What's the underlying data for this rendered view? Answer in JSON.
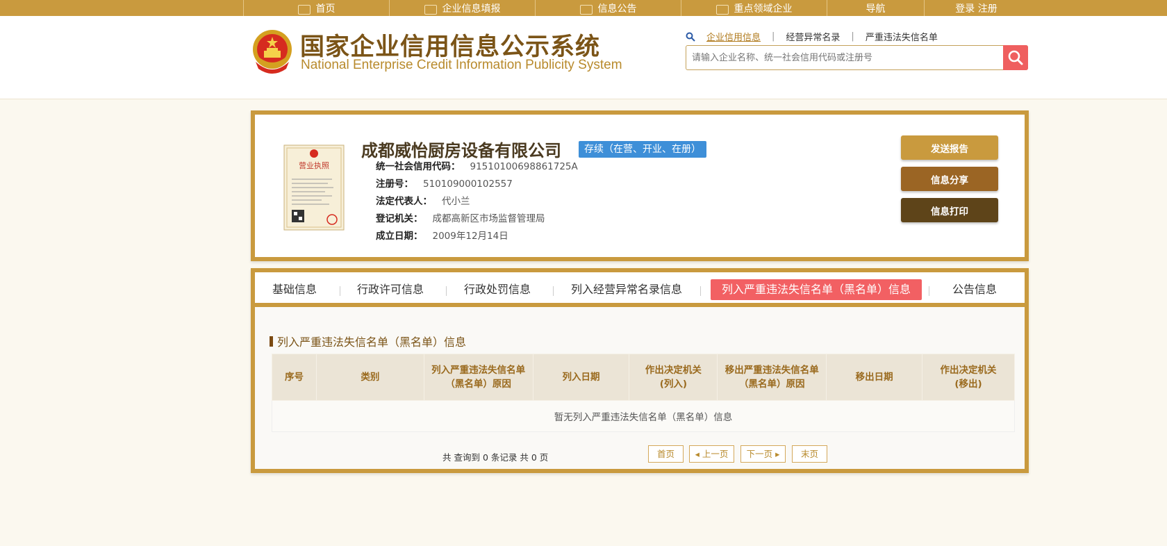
{
  "topnav": {
    "items": [
      {
        "label": "首页",
        "icon": "home-icon"
      },
      {
        "label": "企业信息填报",
        "icon": "edit-icon"
      },
      {
        "label": "信息公告",
        "icon": "notice-icon"
      },
      {
        "label": "重点领域企业",
        "icon": "megaphone-icon"
      },
      {
        "label": "导航",
        "icon": ""
      },
      {
        "label": "登录 注册",
        "icon": ""
      }
    ]
  },
  "header": {
    "title_cn": "国家企业信用信息公示系统",
    "title_en": "National Enterprise Credit Information Publicity System",
    "search_tabs": [
      "企业信用信息",
      "经营异常名录",
      "严重违法失信名单"
    ],
    "search_placeholder": "请输入企业名称、统一社会信用代码或注册号"
  },
  "company": {
    "name": "成都威怡厨房设备有限公司",
    "status": "存续（在营、开业、在册）",
    "fields": [
      {
        "key": "统一社会信用代码：",
        "value": "91510100698861725A"
      },
      {
        "key": "注册号：",
        "value": "510109000102557"
      },
      {
        "key": "法定代表人：",
        "value": "代小兰"
      },
      {
        "key": "登记机关：",
        "value": "成都高新区市场监督管理局"
      },
      {
        "key": "成立日期：",
        "value": "2009年12月14日"
      }
    ],
    "license_text": "营业执照",
    "actions": [
      "发送报告",
      "信息分享",
      "信息打印"
    ]
  },
  "tabs": [
    "基础信息",
    "行政许可信息",
    "行政处罚信息",
    "列入经营异常名录信息",
    "列入严重违法失信名单（黑名单）信息",
    "公告信息"
  ],
  "section": {
    "title": "列入严重违法失信名单（黑名单）信息",
    "columns": [
      "序号",
      "类别",
      "列入严重违法失信名单（黑名单）原因",
      "列入日期",
      "作出决定机关(列入)",
      "移出严重违法失信名单（黑名单）原因",
      "移出日期",
      "作出决定机关(移出)"
    ],
    "empty_text": "暂无列入严重违法失信名单（黑名单）信息"
  },
  "pager": {
    "summary": "共 查询到 0 条记录 共 0 页",
    "first": "首页",
    "prev": "上一页",
    "next": "下一页",
    "last": "末页"
  },
  "colors": {
    "gold": "#c99a3e",
    "brown": "#7b5417",
    "active_tab": "#f26063",
    "status_blue": "#3e8fd8",
    "btn_send": "#c99a3e",
    "btn_share": "#9b6524",
    "btn_print": "#5e4419"
  }
}
